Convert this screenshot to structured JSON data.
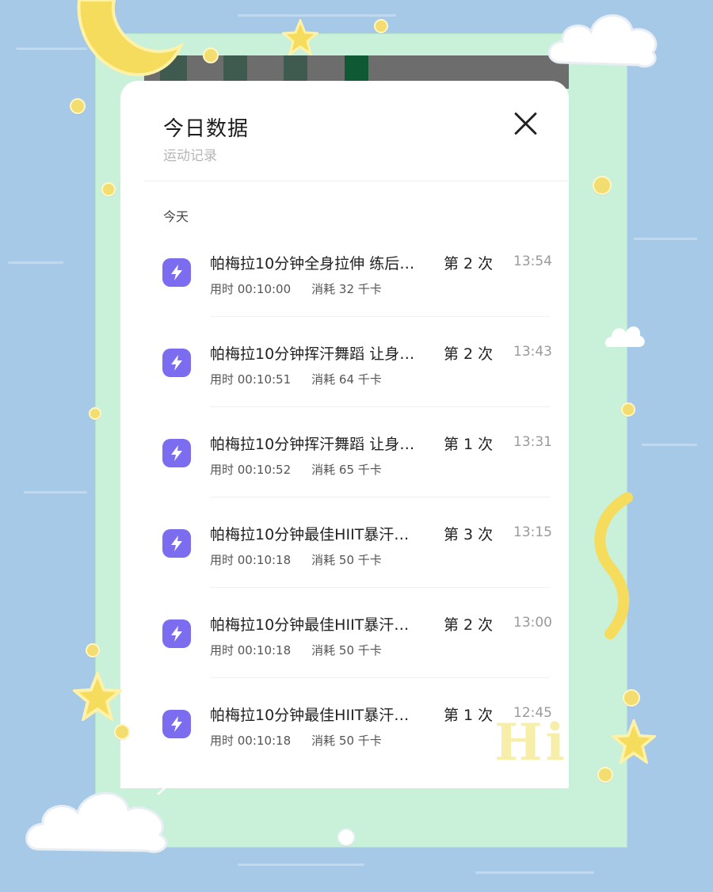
{
  "colors": {
    "background": "#a7c9e8",
    "frame": "#c9f0d8",
    "accent_icon": "#7b6cf0",
    "moon": "#f5dc5c"
  },
  "card": {
    "title": "今日数据",
    "subtitle": "运动记录",
    "close_icon": "close-icon"
  },
  "section_label": "今天",
  "records": [
    {
      "name": "帕梅拉10分钟全身拉伸 练后…",
      "count": "第 2 次",
      "time": "13:54",
      "duration": "用时 00:10:00",
      "calories": "消耗 32 千卡"
    },
    {
      "name": "帕梅拉10分钟挥汗舞蹈 让身…",
      "count": "第 2 次",
      "time": "13:43",
      "duration": "用时 00:10:51",
      "calories": "消耗 64 千卡"
    },
    {
      "name": "帕梅拉10分钟挥汗舞蹈 让身…",
      "count": "第 1 次",
      "time": "13:31",
      "duration": "用时 00:10:52",
      "calories": "消耗 65 千卡"
    },
    {
      "name": "帕梅拉10分钟最佳HIIT暴汗…",
      "count": "第 3 次",
      "time": "13:15",
      "duration": "用时 00:10:18",
      "calories": "消耗 50 千卡"
    },
    {
      "name": "帕梅拉10分钟最佳HIIT暴汗…",
      "count": "第 2 次",
      "time": "13:00",
      "duration": "用时 00:10:18",
      "calories": "消耗 50 千卡"
    },
    {
      "name": "帕梅拉10分钟最佳HIIT暴汗…",
      "count": "第 1 次",
      "time": "12:45",
      "duration": "用时 00:10:18",
      "calories": "消耗 50 千卡"
    }
  ],
  "decorations": {
    "hi_text": "Hi"
  }
}
